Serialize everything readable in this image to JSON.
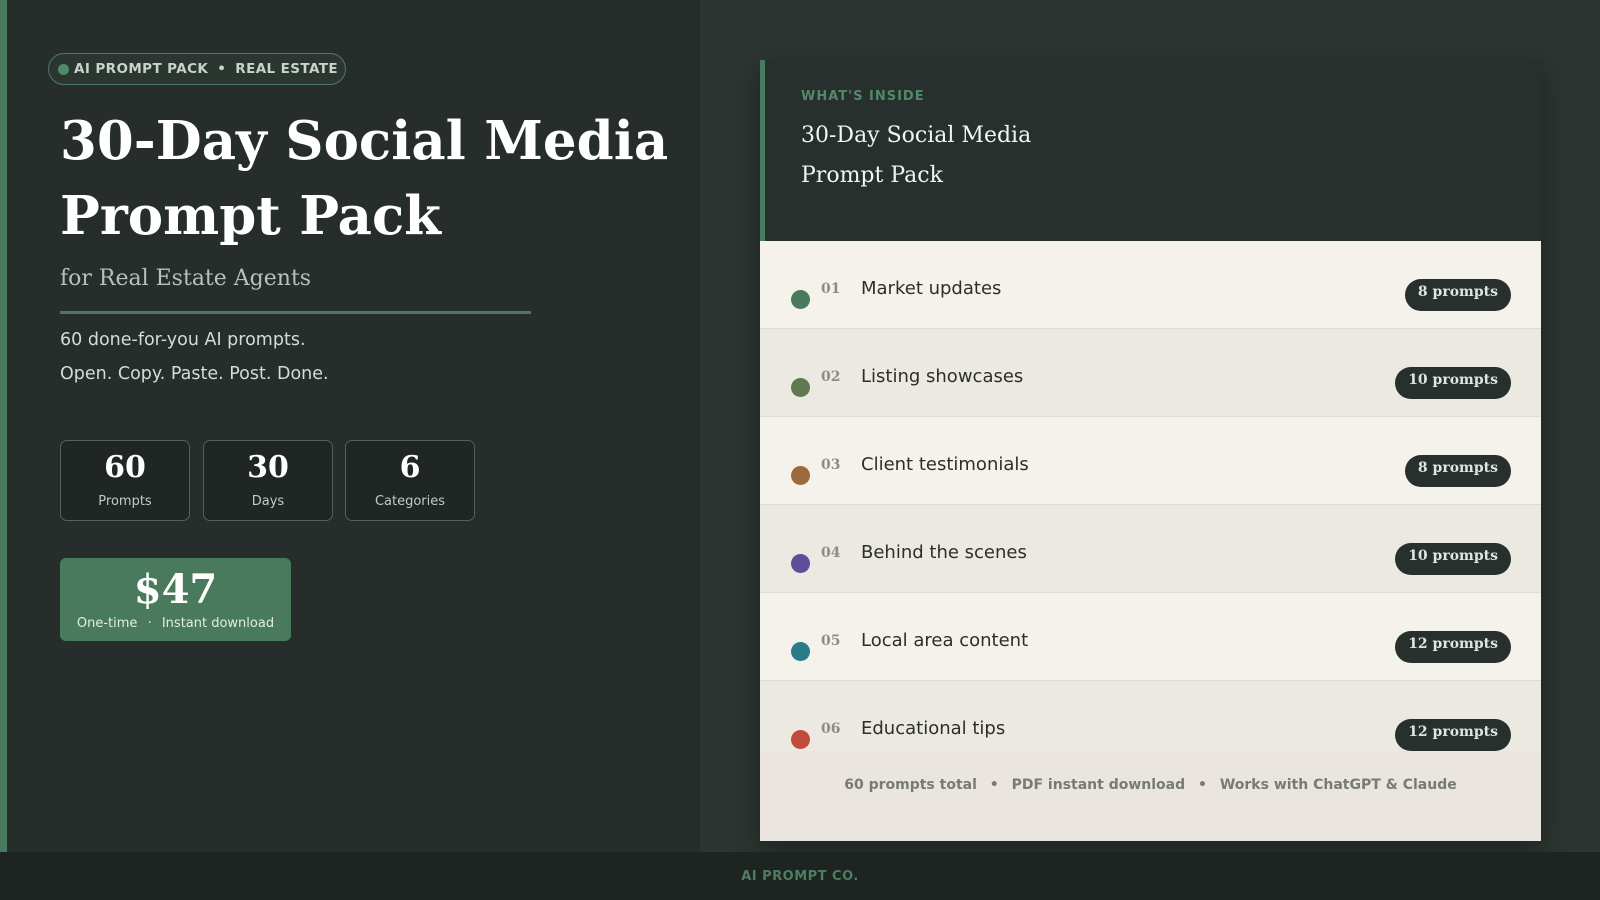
{
  "hero": {
    "tag": {
      "left": "AI PROMPT PACK",
      "separator": "•",
      "right": "REAL ESTATE"
    },
    "title_line1": "30-Day Social Media",
    "title_line2": "Prompt Pack",
    "subtitle": "for Real Estate Agents",
    "desc_line1": "60 done-for-you AI prompts.",
    "desc_line2": "Open. Copy. Paste. Post. Done."
  },
  "stats": [
    {
      "value": "60",
      "label": "Prompts"
    },
    {
      "value": "30",
      "label": "Days"
    },
    {
      "value": "6",
      "label": "Categories"
    }
  ],
  "price": {
    "amount": "$47",
    "note_left": "One-time",
    "separator": "·",
    "note_right": "Instant download"
  },
  "card": {
    "kicker": "WHAT'S INSIDE",
    "title_line1": "30-Day Social Media",
    "title_line2": "Prompt Pack",
    "rows": [
      {
        "index": "01",
        "name": "Market updates",
        "badge": "8 prompts",
        "color": "#4a7a5e"
      },
      {
        "index": "02",
        "name": "Listing showcases",
        "badge": "10 prompts",
        "color": "#5e7a4e"
      },
      {
        "index": "03",
        "name": "Client testimonials",
        "badge": "8 prompts",
        "color": "#9a6a3c"
      },
      {
        "index": "04",
        "name": "Behind the scenes",
        "badge": "10 prompts",
        "color": "#5e4e9a"
      },
      {
        "index": "05",
        "name": "Local area content",
        "badge": "12 prompts",
        "color": "#2a7a8a"
      },
      {
        "index": "06",
        "name": "Educational tips",
        "badge": "12 prompts",
        "color": "#c24a3c"
      }
    ],
    "footer": {
      "part1": "60 prompts total",
      "part2": "PDF instant download",
      "part3": "Works with ChatGPT & Claude",
      "separator": "•"
    }
  },
  "footer": {
    "brand": "AI PROMPT CO."
  },
  "colors": {
    "accent": "#4a7a5e",
    "dark": "#262d2a",
    "card_light": "#f5f2ec"
  }
}
